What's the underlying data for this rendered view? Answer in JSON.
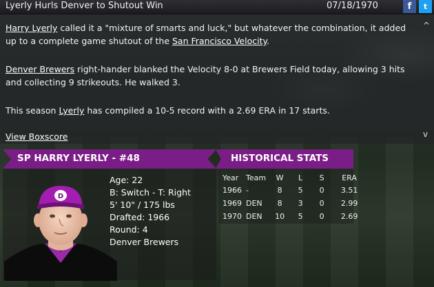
{
  "header": {
    "title": "Lyerly Hurls Denver to Shutout Win",
    "date": "07/18/1970",
    "facebook_icon": "f",
    "twitter_icon": "t"
  },
  "article": {
    "p1_link1": "Harry Lyerly",
    "p1_text1": " called it a \"mixture of smarts and luck,\" but whatever the combination, it added up to a complete game shutout of the ",
    "p1_link2": "San Francisco Velocity",
    "p1_text2": ".",
    "p2_link1": "Denver Brewers",
    "p2_text1": " right-hander blanked the Velocity 8-0 at Brewers Field today, allowing 3 hits and collecting 9 strikeouts. He walked 3.",
    "p3_text1": "This season ",
    "p3_link1": "Lyerly",
    "p3_text2": " has compiled a 10-5 record with a 2.69 ERA in 17 starts.",
    "boxscore_link": "View Boxscore",
    "scroll_up": "^",
    "scroll_down": "v"
  },
  "player": {
    "banner": "SP HARRY LYERLY - #48",
    "age": "Age: 22",
    "bats_throws": "B: Switch - T: Right",
    "height_weight": "5' 10\" / 175 lbs",
    "drafted": "Drafted: 1966",
    "round": "Round: 4",
    "team": "Denver Brewers",
    "cap_color": "#a21db0"
  },
  "history": {
    "banner": "HISTORICAL STATS",
    "headers": [
      "Year",
      "Team",
      "W",
      "L",
      "S",
      "ERA"
    ],
    "rows": [
      [
        "1966",
        "-",
        "8",
        "5",
        "0",
        "3.51"
      ],
      [
        "1969",
        "DEN",
        "8",
        "3",
        "0",
        "2.99"
      ],
      [
        "1970",
        "DEN",
        "10",
        "5",
        "0",
        "2.69"
      ]
    ]
  },
  "colors": {
    "accent": "#7b1d86",
    "facebook": "#3b5998",
    "twitter": "#1da1f2"
  }
}
